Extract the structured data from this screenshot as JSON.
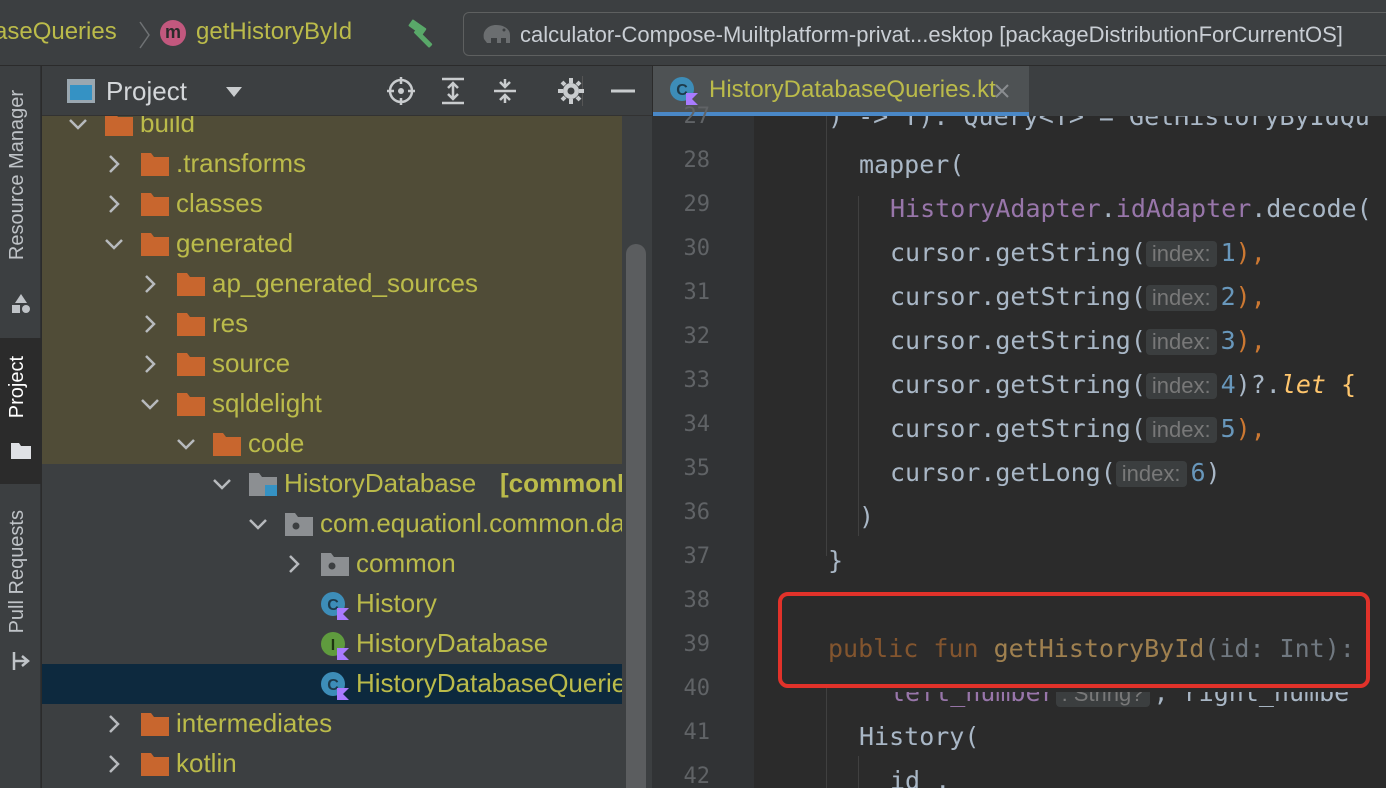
{
  "breadcrumb": {
    "parent": "aseQueries",
    "method_badge": "m",
    "current": "getHistoryById"
  },
  "run_config": {
    "label": "calculator-Compose-Muiltplatform-privat...esktop [packageDistributionForCurrentOS]"
  },
  "side_tabs": {
    "resource_manager": "Resource Manager",
    "project": "Project",
    "pull_requests": "Pull Requests"
  },
  "project_panel": {
    "title": "Project"
  },
  "tree": [
    {
      "label": "build"
    },
    {
      "label": ".transforms"
    },
    {
      "label": "classes"
    },
    {
      "label": "generated"
    },
    {
      "label": "ap_generated_sources"
    },
    {
      "label": "res"
    },
    {
      "label": "source"
    },
    {
      "label": "sqldelight"
    },
    {
      "label": "code"
    },
    {
      "label": "HistoryDatabase",
      "suffix": "[commonMa"
    },
    {
      "label": "com.equationl.common.dat"
    },
    {
      "label": "common"
    },
    {
      "label": "History"
    },
    {
      "label": "HistoryDatabase"
    },
    {
      "label": "HistoryDatabaseQueries"
    },
    {
      "label": "intermediates"
    },
    {
      "label": "kotlin"
    }
  ],
  "editor": {
    "tab_label": "HistoryDatabaseQueries.kt",
    "line_numbers": [
      "27",
      "28",
      "29",
      "30",
      "31",
      "32",
      "33",
      "34",
      "35",
      "36",
      "37",
      "38",
      "39",
      "40",
      "41",
      "42"
    ],
    "hint_index": "index:",
    "hint_string": ": String?",
    "code": {
      "l27": ") -> T): Query<T> = GetHistoryByIdQu",
      "l28": "mapper(",
      "l29a": "HistoryAdapter",
      "l29b": ".",
      "l29c": "idAdapter",
      "l29d": ".decode(",
      "getString": "cursor.getString(",
      "getLong": "cursor.getLong(",
      "n1": "1",
      "n2": "2",
      "n3": "3",
      "n4": "4",
      "n5": "5",
      "n6": "6",
      "comma": "),",
      "close": ")",
      "let_pre": ")?.",
      "let_kw": "let",
      "let_post": " {",
      "l36": ")",
      "l37": "}",
      "l39a": "public fun ",
      "l39b": "getHistoryById",
      "l39c": "(id: Int):",
      "l40a": "left_number",
      "l40b": ", right_numbe",
      "l41": "History(",
      "l42": "id ,"
    }
  }
}
